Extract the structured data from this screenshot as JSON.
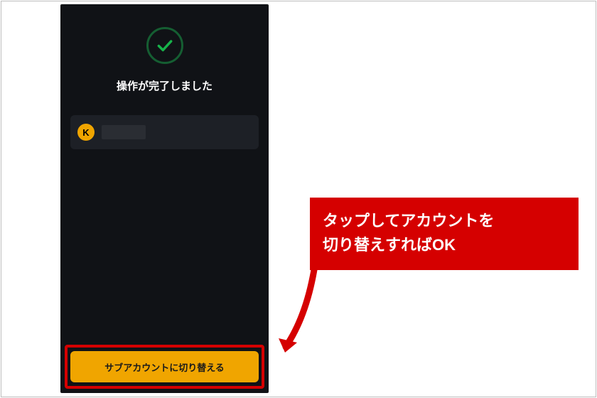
{
  "dialog": {
    "title": "操作が完了しました",
    "account": {
      "avatar_initial": "K"
    },
    "cta_label": "サブアカウントに切り替える"
  },
  "callout": {
    "line1": "タップしてアカウントを",
    "line2": "切り替えすればOK"
  },
  "icons": {
    "success": "checkmark-circle-icon"
  },
  "colors": {
    "accent": "#f0a500",
    "highlight": "#d50000",
    "success_border": "#155e32",
    "success_check": "#17b24a",
    "bg_dark": "#101216"
  }
}
